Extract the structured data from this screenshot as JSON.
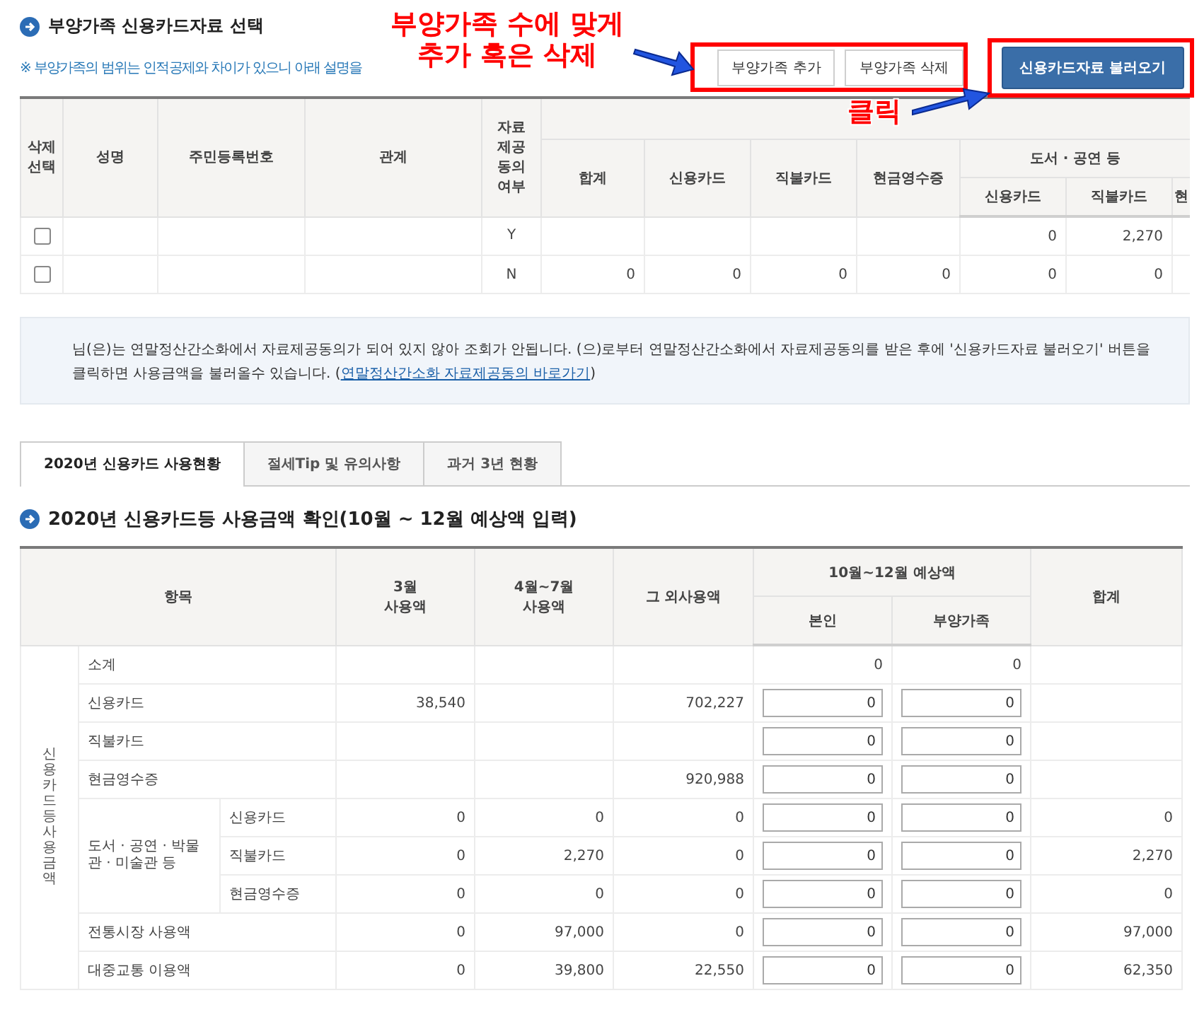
{
  "dependents": {
    "title": "부양가족 신용카드자료 선택",
    "note": "※ 부양가족의 범위는 인적공제와 차이가 있으니 아래 설명을",
    "buttons": [
      "부양가족 추가",
      "부양가족 삭제"
    ],
    "load_button": "신용카드자료 불러오기"
  },
  "annotations": {
    "lines": [
      "부양가족 수에 맞게",
      "추가 혹은 삭제"
    ],
    "click": "클릭"
  },
  "dependent_table": {
    "columns": [
      "삭제\n선택",
      "성명",
      "주민등록번호",
      "관계",
      "자료\n제공\n동의\n여부"
    ],
    "amount_columns": [
      "합계",
      "신용카드",
      "직불카드",
      "현금영수증"
    ],
    "book_group": {
      "label": "도서 · 공연 등",
      "columns": [
        "신용카드",
        "직불카드",
        "현"
      ]
    },
    "rows": [
      {
        "checked": false,
        "consent": "Y",
        "cells": [
          null,
          null,
          null,
          null,
          "0",
          "2,270"
        ]
      },
      {
        "checked": false,
        "consent": "N",
        "cells": [
          "0",
          "0",
          "0",
          "0",
          "0",
          "0"
        ]
      }
    ]
  },
  "info": {
    "before": "님(은)는 연말정산간소화에서 자료제공동의가 되어 있지 않아 조회가 안됩니다.            (으)로부터 연말정산간소화에서 자료제공동의를 받은 후에 '신용카드자료 불러오기' 버튼을 클릭하면 사용금액을 불러올수 있습니다. (",
    "link": "연말정산간소화 자료제공동의 바로가기",
    "after": ")"
  },
  "tabs": [
    {
      "label": "2020년 신용카드 사용현황",
      "selected": true
    },
    {
      "label": "절세Tip 및 유의사항",
      "selected": false
    },
    {
      "label": "과거 3년 현황",
      "selected": false
    }
  ],
  "usage": {
    "title": "2020년 신용카드등 사용금액 확인(10월 ~ 12월 예상액 입력)",
    "headers": {
      "item": "항목",
      "march": "3월\n사용액",
      "apr_jul": "4월~7월\n사용액",
      "other": "그 외사용액",
      "estimate": "10월~12월 예상액",
      "self": "본인",
      "dependent": "부양가족",
      "total": "합계"
    },
    "side_label": "신용카드등 사용금액",
    "rows": [
      {
        "label": "소계",
        "input": false,
        "self": "0",
        "dependent": "0"
      },
      {
        "label": "신용카드",
        "input": true,
        "march": "38,540",
        "other": "702,227",
        "self": "0",
        "dependent": "0"
      },
      {
        "label": "직불카드",
        "input": true,
        "self": "0",
        "dependent": "0"
      },
      {
        "label": "현금영수증",
        "input": true,
        "other": "920,988",
        "self": "0",
        "dependent": "0"
      },
      {
        "label": "도서 · 공연 · 박물관 · 미술관 등",
        "children": [
          {
            "label": "신용카드",
            "input": true,
            "march": "0",
            "apr_jul": "0",
            "other": "0",
            "self": "0",
            "dependent": "0",
            "total": "0"
          },
          {
            "label": "직불카드",
            "input": true,
            "march": "0",
            "apr_jul": "2,270",
            "other": "0",
            "self": "0",
            "dependent": "0",
            "total": "2,270"
          },
          {
            "label": "현금영수증",
            "input": true,
            "march": "0",
            "apr_jul": "0",
            "other": "0",
            "self": "0",
            "dependent": "0",
            "total": "0"
          }
        ]
      },
      {
        "label": "전통시장 사용액",
        "input": true,
        "march": "0",
        "apr_jul": "97,000",
        "other": "0",
        "self": "0",
        "dependent": "0",
        "total": "97,000"
      },
      {
        "label": "대중교통 이용액",
        "input": true,
        "march": "0",
        "apr_jul": "39,800",
        "other": "22,550",
        "self": "0",
        "dependent": "0",
        "total": "62,350"
      }
    ]
  }
}
